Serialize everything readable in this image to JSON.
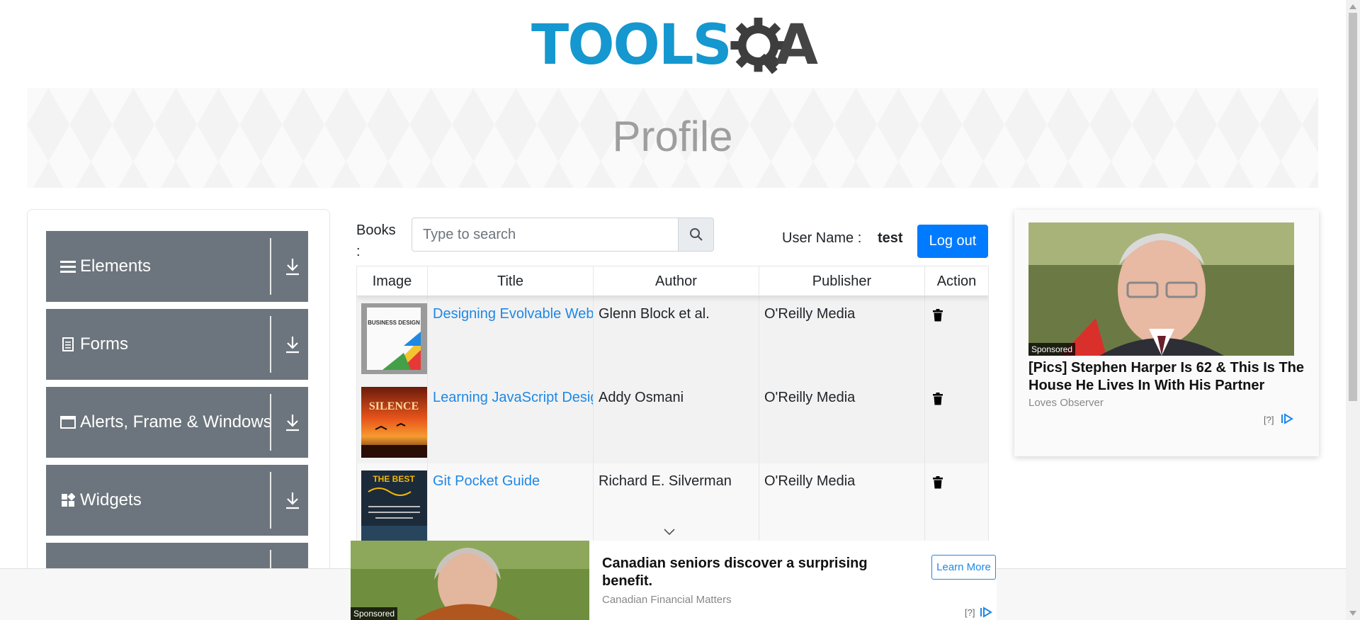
{
  "header": {
    "logo_text": "TOOLS",
    "logo_suffix": "A"
  },
  "page": {
    "title": "Profile"
  },
  "sidebar": {
    "groups": [
      {
        "label": "Elements",
        "icon": "hamburger-icon"
      },
      {
        "label": "Forms",
        "icon": "document-icon"
      },
      {
        "label": "Alerts, Frame & Windows",
        "icon": "window-icon"
      },
      {
        "label": "Widgets",
        "icon": "widgets-icon"
      }
    ]
  },
  "search": {
    "label": "Books :",
    "placeholder": "Type to search"
  },
  "user": {
    "label": "User Name :",
    "value": "test",
    "logout_label": "Log out"
  },
  "table": {
    "headers": [
      "Image",
      "Title",
      "Author",
      "Publisher",
      "Action"
    ],
    "rows": [
      {
        "title": "Designing Evolvable Web APIs with ASP.NET",
        "author": "Glenn Block et al.",
        "publisher": "O'Reilly Media",
        "cover": "BUSINESS DESIGN"
      },
      {
        "title": "Learning JavaScript Design Patterns",
        "author": "Addy Osmani",
        "publisher": "O'Reilly Media",
        "cover": "SILENCE"
      },
      {
        "title": "Git Pocket Guide",
        "author": "Richard E. Silverman",
        "publisher": "O'Reilly Media",
        "cover": "THE BEST"
      }
    ]
  },
  "ad_right": {
    "sponsored": "Sponsored",
    "title": "[Pics] Stephen Harper Is 62 & This Is The House He Lives In With His Partner",
    "source": "Loves Observer",
    "info": "[?]"
  },
  "ad_bottom": {
    "sponsored": "Sponsored",
    "title": "Canadian seniors discover a surprising benefit.",
    "source": "Canadian Financial Matters",
    "cta": "Learn More",
    "info": "[?]"
  },
  "colors": {
    "brand_blue": "#1597cf",
    "primary_button": "#007bff",
    "sidebar_group": "#6c757d",
    "link": "#1e88e5"
  }
}
